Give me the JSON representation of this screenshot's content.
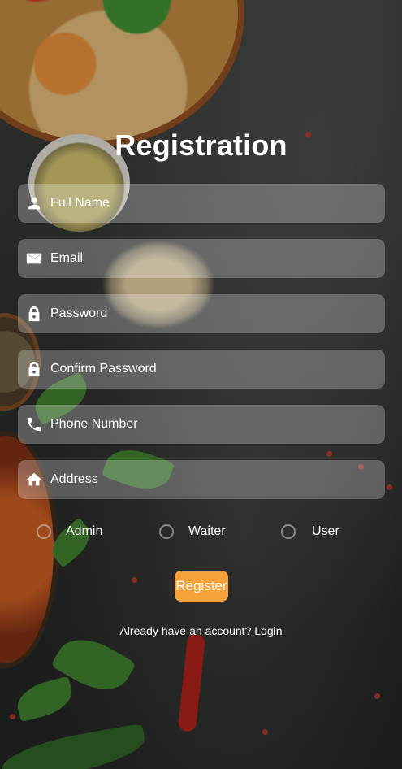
{
  "page": {
    "title": "Registration"
  },
  "form": {
    "fields": [
      {
        "icon": "person-icon",
        "placeholder": "Full Name",
        "value": ""
      },
      {
        "icon": "email-icon",
        "placeholder": "Email",
        "value": ""
      },
      {
        "icon": "lock-icon",
        "placeholder": "Password",
        "value": ""
      },
      {
        "icon": "lock-icon",
        "placeholder": "Confirm Password",
        "value": ""
      },
      {
        "icon": "phone-icon",
        "placeholder": "Phone Number",
        "value": ""
      },
      {
        "icon": "home-icon",
        "placeholder": "Address",
        "value": ""
      }
    ],
    "roles": [
      "Admin",
      "Waiter",
      "User"
    ],
    "selected_role": null,
    "register_label": "Register",
    "login_link": "Already have an account? Login"
  },
  "colors": {
    "accent": "#f5a23c",
    "field_background": "rgba(255,255,255,0.26)",
    "text": "#ffffff"
  }
}
